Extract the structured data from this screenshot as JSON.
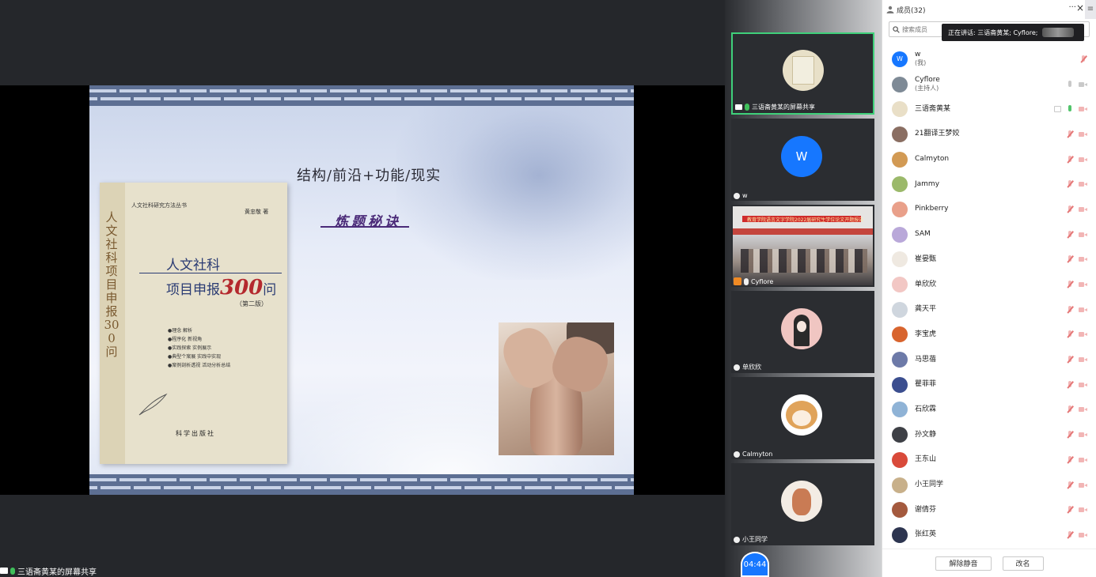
{
  "slide": {
    "title": "结构/前沿+功能/现实",
    "subtitle": "炼题秘诀",
    "book": {
      "series": "人文社科研究方法丛书",
      "author": "黄忠敬  著",
      "title_line1": "人文社科",
      "title_line2_prefix": "项目申报",
      "title_line2_number": "300",
      "title_line2_suffix": "问",
      "edition": "（第二版）",
      "vertical_title": "人文社科项目申报300问",
      "bullets": [
        "●理念  解析",
        "●程序化  新视角",
        "●实践探索  实例展示",
        "●典型个案展  实践中实现",
        "●案例剖析透视  活动分析总结"
      ],
      "publisher": "科学出版社"
    }
  },
  "share_status": {
    "label": "三语斋黄某的屏幕共享"
  },
  "video_tiles": [
    {
      "name": "三语斋黄某的屏幕共享",
      "mic": "green",
      "active": true,
      "kind": "screen"
    },
    {
      "name": "w",
      "initial": "W",
      "mic": "off",
      "kind": "avatar"
    },
    {
      "name": "Cyflore",
      "mic": "white",
      "kind": "camera",
      "banner": "教育学院语言文字学院2022届研究生学位论文开题报告"
    },
    {
      "name": "单欣欣",
      "mic": "off",
      "kind": "avatar"
    },
    {
      "name": "Calmyton",
      "mic": "off",
      "kind": "avatar"
    },
    {
      "name": "小王同学",
      "mic": "off",
      "kind": "avatar"
    }
  ],
  "timer": "04:44",
  "panel": {
    "title": "成员(32)",
    "more": "···",
    "close": "×",
    "menu": "≡",
    "search_placeholder": "搜索成员",
    "tooltip": "正在讲话: 三语斋黄某; Cyflore;",
    "footer": {
      "unmute_label": "解除静音",
      "rename_label": "改名"
    }
  },
  "members": [
    {
      "name": "w",
      "role": "(我)",
      "avatar_color": "#1677ff",
      "initial": "W",
      "icons": [
        "mic-off"
      ]
    },
    {
      "name": "Cyflore",
      "role": "(主持人)",
      "avatar_color": "#7e8a96",
      "initial": "",
      "icons": [
        "mic-grey",
        "cam-grey"
      ]
    },
    {
      "name": "三语斋黄某",
      "role": "",
      "avatar_color": "#e9dfc7",
      "initial": "",
      "icons": [
        "screen",
        "mic-on",
        "cam-off"
      ]
    },
    {
      "name": "21翻译王梦姣",
      "role": "",
      "avatar_color": "#8a6e62",
      "initial": "",
      "icons": [
        "mic-off",
        "cam-off"
      ]
    },
    {
      "name": "Calmyton",
      "role": "",
      "avatar_color": "#d29a54",
      "initial": "",
      "icons": [
        "mic-off",
        "cam-off"
      ]
    },
    {
      "name": "Jammy",
      "role": "",
      "avatar_color": "#9bb96a",
      "initial": "",
      "icons": [
        "mic-off",
        "cam-off"
      ]
    },
    {
      "name": "Pinkberry",
      "role": "",
      "avatar_color": "#e9a08a",
      "initial": "",
      "icons": [
        "mic-off",
        "cam-off"
      ]
    },
    {
      "name": "SAM",
      "role": "",
      "avatar_color": "#b9a8d9",
      "initial": "",
      "icons": [
        "mic-off",
        "cam-off"
      ]
    },
    {
      "name": "崔晏甄",
      "role": "",
      "avatar_color": "#efe9e1",
      "initial": "",
      "icons": [
        "mic-off",
        "cam-off"
      ]
    },
    {
      "name": "单欣欣",
      "role": "",
      "avatar_color": "#f2c7c4",
      "initial": "",
      "icons": [
        "mic-off",
        "cam-off"
      ]
    },
    {
      "name": "龚天平",
      "role": "",
      "avatar_color": "#cfd6de",
      "initial": "",
      "icons": [
        "mic-off",
        "cam-off"
      ]
    },
    {
      "name": "李宝虎",
      "role": "",
      "avatar_color": "#d8642e",
      "initial": "",
      "icons": [
        "mic-off",
        "cam-off"
      ]
    },
    {
      "name": "马思蓓",
      "role": "",
      "avatar_color": "#6d7aa8",
      "initial": "",
      "icons": [
        "mic-off",
        "cam-off"
      ]
    },
    {
      "name": "瞿菲菲",
      "role": "",
      "avatar_color": "#3b4e8f",
      "initial": "",
      "icons": [
        "mic-off",
        "cam-off"
      ]
    },
    {
      "name": "石欣霖",
      "role": "",
      "avatar_color": "#8fb3d6",
      "initial": "",
      "icons": [
        "mic-off",
        "cam-off"
      ]
    },
    {
      "name": "孙文静",
      "role": "",
      "avatar_color": "#3e4046",
      "initial": "",
      "icons": [
        "mic-off",
        "cam-off"
      ]
    },
    {
      "name": "王东山",
      "role": "",
      "avatar_color": "#d94a3a",
      "initial": "",
      "icons": [
        "mic-off",
        "cam-off"
      ]
    },
    {
      "name": "小王同学",
      "role": "",
      "avatar_color": "#c8b08a",
      "initial": "",
      "icons": [
        "mic-off",
        "cam-off"
      ]
    },
    {
      "name": "谢倩芬",
      "role": "",
      "avatar_color": "#a45a3e",
      "initial": "",
      "icons": [
        "mic-off",
        "cam-off"
      ]
    },
    {
      "name": "张红英",
      "role": "",
      "avatar_color": "#2d3550",
      "initial": "",
      "icons": [
        "mic-off",
        "cam-off"
      ]
    }
  ]
}
